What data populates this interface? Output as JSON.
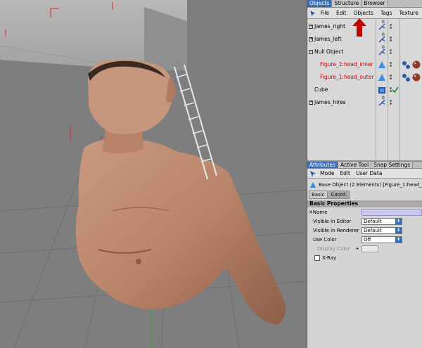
{
  "objects_manager": {
    "tabs": [
      "Objects",
      "Structure",
      "Browser"
    ],
    "menu": [
      "File",
      "Edit",
      "Objects",
      "Tags",
      "Texture"
    ],
    "items": [
      {
        "name": "James_right",
        "expander": "+",
        "red": false
      },
      {
        "name": "James_left",
        "expander": "+",
        "red": false
      },
      {
        "name": "Null Object",
        "expander": "-",
        "red": false
      },
      {
        "name": "Figure_1:head_inner",
        "expander": "",
        "red": true
      },
      {
        "name": "Figure_1:head_outer",
        "expander": "",
        "red": true
      },
      {
        "name": "Cube",
        "expander": "",
        "red": false
      },
      {
        "name": "James_hires",
        "expander": "+",
        "red": false
      }
    ],
    "layer_value": "0"
  },
  "attributes_manager": {
    "tabs": [
      "Attributes",
      "Active Tool",
      "Snap Settings"
    ],
    "menu": [
      "Mode",
      "Edit",
      "User Data"
    ],
    "base_object_label": "Base Object (2 Elements) [Figure_1:head_",
    "subtabs": [
      "Basic",
      "Coord."
    ],
    "section_title": "Basic Properties",
    "properties": {
      "name_label": "Name",
      "visible_editor_label": "Visible in Editor",
      "visible_editor_value": "Default",
      "visible_renderer_label": "Visible in Renderer",
      "visible_renderer_value": "Default",
      "use_color_label": "Use Color",
      "use_color_value": "Off",
      "display_color_label": "Display Color",
      "xray_label": "X-Ray"
    }
  },
  "colors": {
    "accent": "#3a6fb5",
    "selected_red": "#d40000",
    "annotation_arrow": "#c00000",
    "viewport_bg": "#7e7e7e"
  }
}
